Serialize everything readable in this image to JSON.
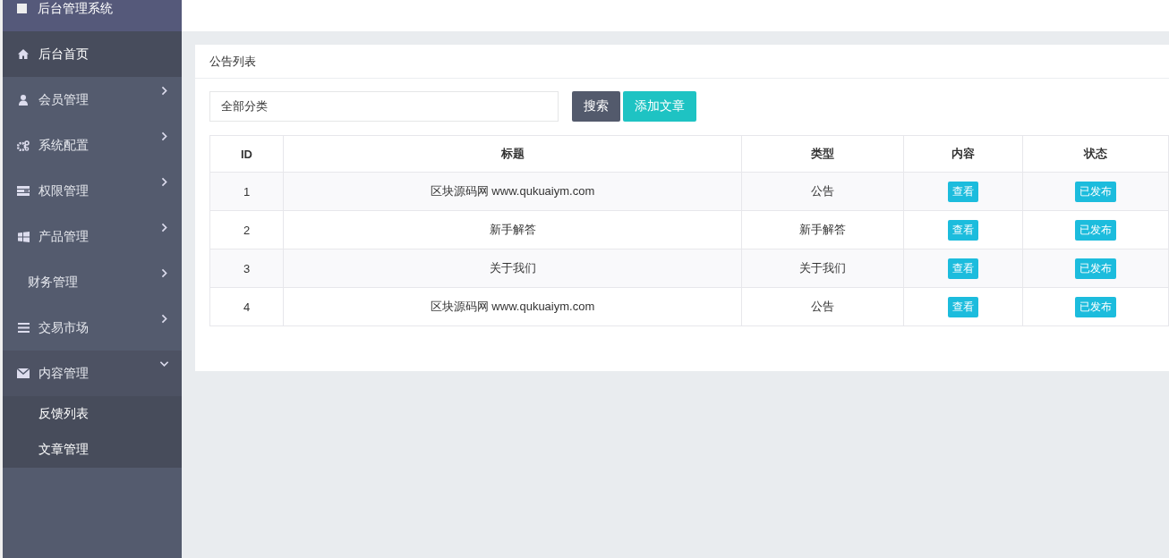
{
  "sidebar": {
    "title": "后台管理系统",
    "items": [
      {
        "label": "后台首页",
        "kind": "link",
        "selected": true
      },
      {
        "label": "会员管理",
        "kind": "group",
        "selected": false,
        "expanded": false
      },
      {
        "label": "系统配置",
        "kind": "group",
        "selected": false,
        "expanded": false
      },
      {
        "label": "权限管理",
        "kind": "group",
        "selected": false,
        "expanded": false
      },
      {
        "label": "产品管理",
        "kind": "group",
        "selected": false,
        "expanded": false
      },
      {
        "label": "财务管理",
        "kind": "group",
        "selected": false,
        "expanded": false
      },
      {
        "label": "交易市场",
        "kind": "group",
        "selected": false,
        "expanded": false
      },
      {
        "label": "内容管理",
        "kind": "group",
        "selected": false,
        "expanded": true,
        "children": [
          {
            "label": "反馈列表"
          },
          {
            "label": "文章管理"
          }
        ]
      }
    ]
  },
  "card": {
    "title": "公告列表",
    "category_select": {
      "value": "全部分类"
    },
    "buttons": [
      "搜索",
      "添加文章"
    ],
    "table": {
      "columns": [
        "ID",
        "标题",
        "类型",
        "内容",
        "状态"
      ],
      "rows": [
        {
          "id": "1",
          "title": "区块源码网 www.qukuaiym.com",
          "type": "公告",
          "content": "查看",
          "status": "已发布"
        },
        {
          "id": "2",
          "title": "新手解答",
          "type": "新手解答",
          "content": "查看",
          "status": "已发布"
        },
        {
          "id": "3",
          "title": "关于我们",
          "type": "关于我们",
          "content": "查看",
          "status": "已发布"
        },
        {
          "id": "4",
          "title": "区块源码网 www.qukuaiym.com",
          "type": "公告",
          "content": "查看",
          "status": "已发布"
        }
      ]
    }
  }
}
